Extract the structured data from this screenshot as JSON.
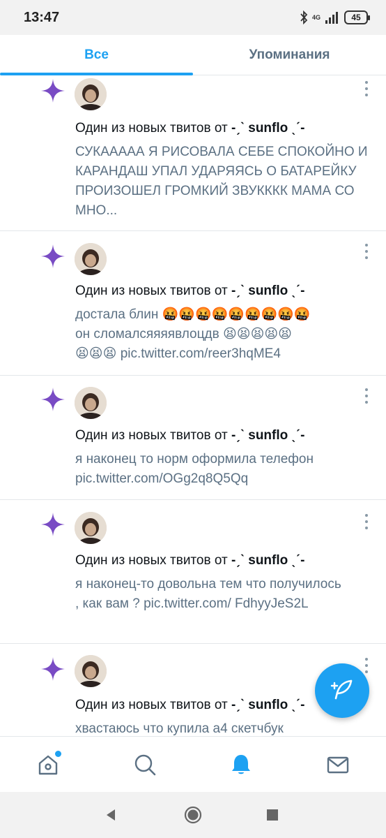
{
  "status_bar": {
    "time": "13:47",
    "network": "4G",
    "battery": "45"
  },
  "tabs": [
    {
      "label": "Все",
      "active": true
    },
    {
      "label": "Упоминания",
      "active": false
    }
  ],
  "feed": {
    "items": [
      {
        "headline_prefix": "Один из новых твитов от",
        "author": "-ˏˋ sunflo ˎˊ-",
        "text": "СУКААААА Я РИСОВАЛА СЕБЕ СПОКОЙНО И КАРАНДАШ УПАЛ УДАРЯЯСЬ О БАТАРЕЙКУ ПРОИЗОШЕЛ ГРОМКИЙ ЗВУКККК МАМА СО МНО..."
      },
      {
        "headline_prefix": "Один из новых твитов от",
        "author": "-ˏˋ sunflo ˎˊ-",
        "text_line1": "достала блин",
        "emoji_rage": "🤬🤬🤬🤬🤬🤬🤬🤬🤬",
        "text_line2": "он сломалсяяяявлоцдв",
        "emoji_tired_a": "😫😫😫😫😫",
        "emoji_tired_b": "😫😫😫",
        "link": "pic.twitter.com/reer3hqME4"
      },
      {
        "headline_prefix": "Один из новых твитов от",
        "author": "-ˏˋ sunflo ˎˊ-",
        "text": "я наконец то норм оформила телефон pic.twitter.com/OGg2q8Q5Qq"
      },
      {
        "headline_prefix": "Один из новых твитов от",
        "author": "-ˏˋ sunflo ˎˊ-",
        "text": "я наконец-то довольна тем что получилось , как вам ? pic.twitter.com/ FdhyyJeS2L"
      },
      {
        "headline_prefix": "Один из новых твитов от",
        "author": "-ˏˋ sunflo ˎˊ-",
        "text": "хвастаюсь что купила а4 скетчбук"
      }
    ]
  },
  "icons": {
    "sparkle": "sparkle-icon",
    "more": "more-vertical-icon",
    "compose": "compose-tweet-icon",
    "nav": [
      "home-icon",
      "search-icon",
      "notifications-bell-icon",
      "messages-envelope-icon"
    ],
    "system": [
      "back-icon",
      "home-circle-icon",
      "recents-square-icon"
    ]
  },
  "colors": {
    "accent": "#1da1f2",
    "sparkle": "#794bc4",
    "secondary_text": "#5b7083",
    "primary_text": "#0f1419"
  }
}
